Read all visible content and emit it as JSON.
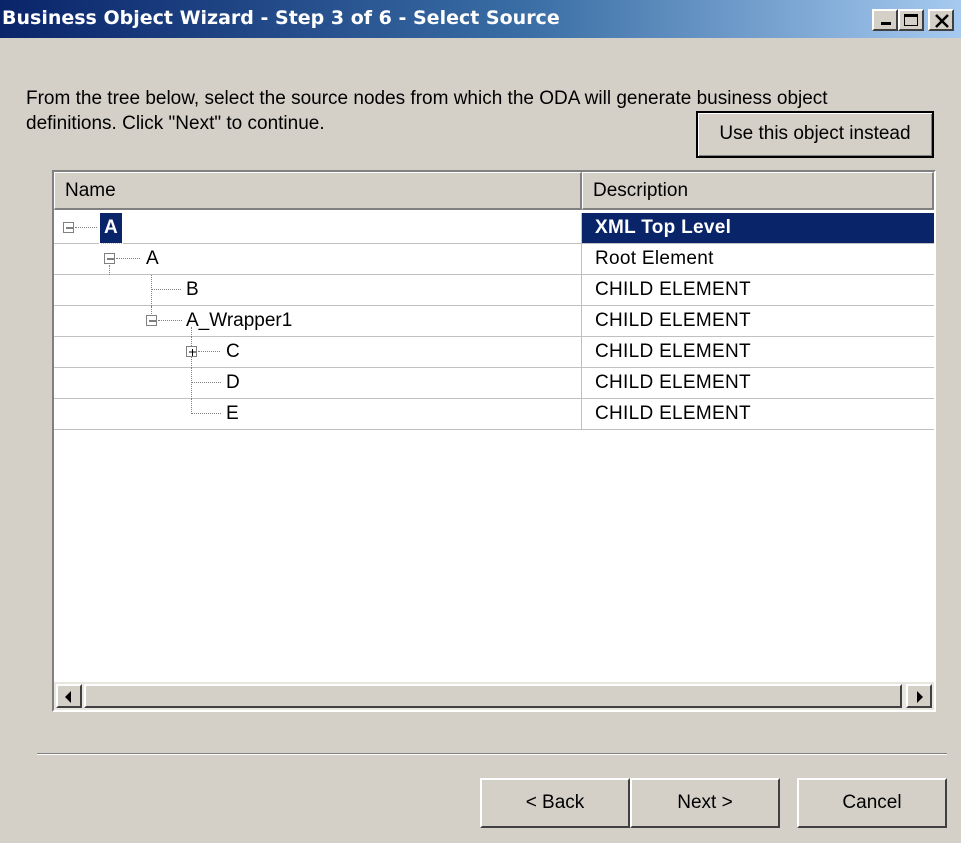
{
  "window": {
    "title": "Business Object Wizard - Step 3 of 6 - Select Source"
  },
  "intro": {
    "text": "From the tree below, select the source nodes from which the ODA will generate business object definitions. Click \"Next\" to continue."
  },
  "buttons": {
    "use_object": "Use this object instead",
    "back": "< Back",
    "next": "Next >",
    "cancel": "Cancel"
  },
  "tree": {
    "columns": {
      "name": "Name",
      "description": "Description"
    },
    "rows": [
      {
        "name": "A",
        "description": "XML Top Level",
        "selected": true,
        "expanded": true
      },
      {
        "name": "A",
        "description": "Root Element",
        "expanded": true
      },
      {
        "name": "B",
        "description": "CHILD ELEMENT"
      },
      {
        "name": "A_Wrapper1",
        "description": "CHILD ELEMENT",
        "expanded": true
      },
      {
        "name": "C",
        "description": "CHILD ELEMENT",
        "expanded": false
      },
      {
        "name": "D",
        "description": "CHILD ELEMENT"
      },
      {
        "name": "E",
        "description": "CHILD ELEMENT"
      }
    ]
  },
  "colors": {
    "selection": "#0a246a",
    "face": "#d4d0c8",
    "title_start": "#0a246a",
    "title_end": "#a6caf0"
  },
  "icons": [
    "minimize-icon",
    "maximize-icon",
    "close-icon",
    "collapse-icon",
    "expand-icon",
    "scroll-left-icon",
    "scroll-right-icon"
  ]
}
